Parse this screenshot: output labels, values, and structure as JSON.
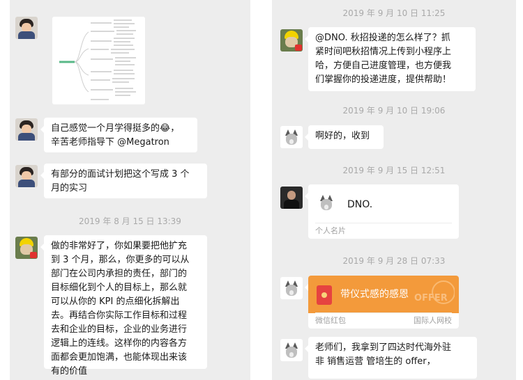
{
  "left": {
    "messages": [
      {
        "type": "image",
        "name": "mind-map-image",
        "description": "mind map screenshot"
      },
      {
        "type": "text",
        "lines": [
          "自己感觉一个月学得挺多的😂，",
          "辛苦老师指导下 @Megatron"
        ]
      },
      {
        "type": "text",
        "lines": [
          "有部分的面试计划把这个写成 3 个",
          "月的实习"
        ]
      },
      {
        "type": "text",
        "lines": [
          "做的非常好了，你如果要把他扩充",
          "到 3 个月，那么，你更多的可以从",
          "部门在公司内承担的责任，部门的",
          "目标细化到个人的目标上，那么就",
          "可以从你的 KPI 的点细化拆解出",
          "去。再结合你实际工作目标和过程",
          "去和企业的目标，企业的业务进行",
          "逻辑上的连线。这样你的内容各方",
          "面都会更加饱满，也能体现出来该",
          "有的价值"
        ]
      }
    ],
    "timestamp_1": "2019 年 8 月 15 日  13:39"
  },
  "right": {
    "timestamp_1": "2019 年 9 月 10 日  11:25",
    "msg_1_lines": [
      "@DNO. 秋招投递的怎么样了？抓",
      "紧时间吧秋招情况上传到小程序上",
      "哈，方便自己进度管理，也方便我",
      "们掌握你的投递进度，提供帮助！"
    ],
    "timestamp_2": "2019 年 9 月 10 日  19:06",
    "msg_2": "啊好的，收到",
    "timestamp_3": "2019 年 9 月 15 日  12:51",
    "contact_card": {
      "name": "DNO.",
      "footer": "个人名片"
    },
    "timestamp_4": "2019 年 9 月 28 日  07:33",
    "red_packet": {
      "text": "带仪式感的感恩",
      "footer_left": "微信红包",
      "footer_right": "国际人网校",
      "deco_text": "OFFER"
    },
    "msg_3_lines": [
      "老师们，我拿到了四达时代海外驻",
      "非 销售运营 管培生的 offer，"
    ]
  },
  "colors": {
    "chat_bg": "#ededed",
    "bubble_bg": "#ffffff",
    "timestamp": "#a9a9a9",
    "red_packet": "#f39a3b"
  }
}
